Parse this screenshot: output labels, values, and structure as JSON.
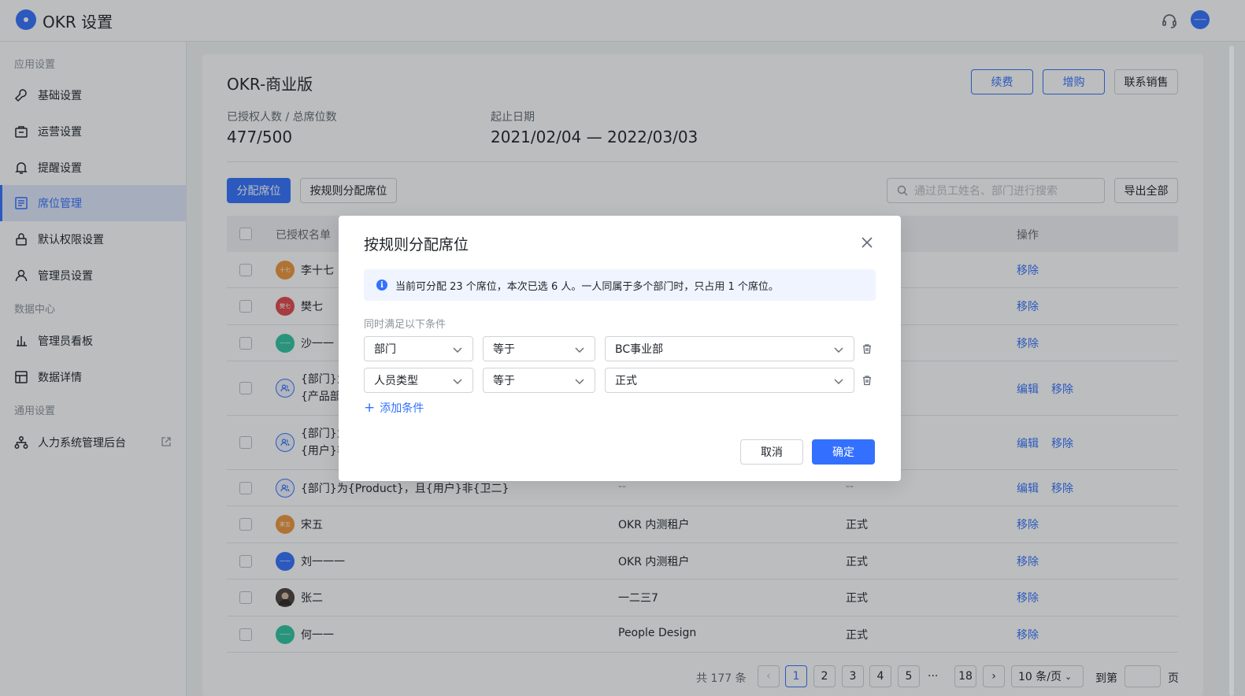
{
  "app": {
    "title": "OKR 设置"
  },
  "header": {
    "avatar_text": "一一"
  },
  "sidebar": {
    "groups": [
      "应用设置",
      "数据中心",
      "通用设置"
    ],
    "items": [
      {
        "label": "基础设置"
      },
      {
        "label": "运营设置"
      },
      {
        "label": "提醒设置"
      },
      {
        "label": "席位管理"
      },
      {
        "label": "默认权限设置"
      },
      {
        "label": "管理员设置"
      },
      {
        "label": "管理员看板"
      },
      {
        "label": "数据详情"
      },
      {
        "label": "人力系统管理后台"
      }
    ],
    "active_index": 3
  },
  "main": {
    "title": "OKR-商业版",
    "actions": {
      "renew": "续费",
      "add": "增购",
      "contact": "联系销售"
    },
    "stats": {
      "seats_label": "已授权人数 / 总席位数",
      "seats_value": "477/500",
      "date_label": "起止日期",
      "date_value": "2021/02/04 — 2022/03/03"
    },
    "toolbar": {
      "assign": "分配席位",
      "assign_by_rule": "按规则分配席位",
      "search_placeholder": "通过员工姓名、部门进行搜索",
      "export": "导出全部"
    },
    "table": {
      "headers": {
        "name": "已授权名单",
        "ops": "操作"
      },
      "rows": [
        {
          "name": "李十七",
          "avatar": "十七",
          "dept": "",
          "type": "",
          "ops": [
            "移除"
          ]
        },
        {
          "name": "樊七",
          "avatar": "樊七",
          "dept": "",
          "type": "",
          "ops": [
            "移除"
          ]
        },
        {
          "name": "沙一一",
          "avatar": "一一",
          "dept": "",
          "type": "",
          "ops": [
            "移除"
          ]
        },
        {
          "name_line1": "{部门}为",
          "name_line2": "{产品部",
          "ops": [
            "编辑",
            "移除"
          ]
        },
        {
          "name_line1": "{部门}为",
          "name_line2": "{用户}非",
          "ops": [
            "编辑",
            "移除"
          ]
        },
        {
          "name": "{部门}为{Product}，且{用户}非{卫二}",
          "dept": "--",
          "type": "--",
          "ops": [
            "编辑",
            "移除"
          ]
        },
        {
          "name": "宋五",
          "avatar": "宋五",
          "dept": "OKR 内测租户",
          "type": "正式",
          "ops": [
            "移除"
          ]
        },
        {
          "name": "刘一一一",
          "avatar": "一一",
          "dept": "OKR 内测租户",
          "type": "正式",
          "ops": [
            "移除"
          ]
        },
        {
          "name": "张二",
          "avatar": "",
          "dept": "一二三7",
          "type": "正式",
          "ops": [
            "移除"
          ]
        },
        {
          "name": "何一一",
          "avatar": "一一",
          "dept": "People Design",
          "type": "正式",
          "ops": [
            "移除"
          ]
        }
      ]
    },
    "pagination": {
      "total": "共 177 条",
      "pages": [
        "1",
        "2",
        "3",
        "4",
        "5"
      ],
      "ellipsis": "···",
      "last": "18",
      "current": 1,
      "page_size": "10 条/页",
      "goto_prefix": "到第",
      "goto_suffix": "页"
    }
  },
  "modal": {
    "title": "按规则分配席位",
    "alert": "当前可分配 23 个席位，本次已选 6 人。一人同属于多个部门时，只占用 1 个席位。",
    "condition_label": "同时满足以下条件",
    "conditions": [
      {
        "field": "部门",
        "operator": "等于",
        "value": "BC事业部"
      },
      {
        "field": "人员类型",
        "operator": "等于",
        "value": "正式"
      }
    ],
    "add_condition": "添加条件",
    "cancel": "取消",
    "confirm": "确定"
  },
  "colors": {
    "primary": "#3370ff",
    "orange": "#f0963a",
    "red": "#e2474b",
    "green": "#2ec4a0"
  }
}
